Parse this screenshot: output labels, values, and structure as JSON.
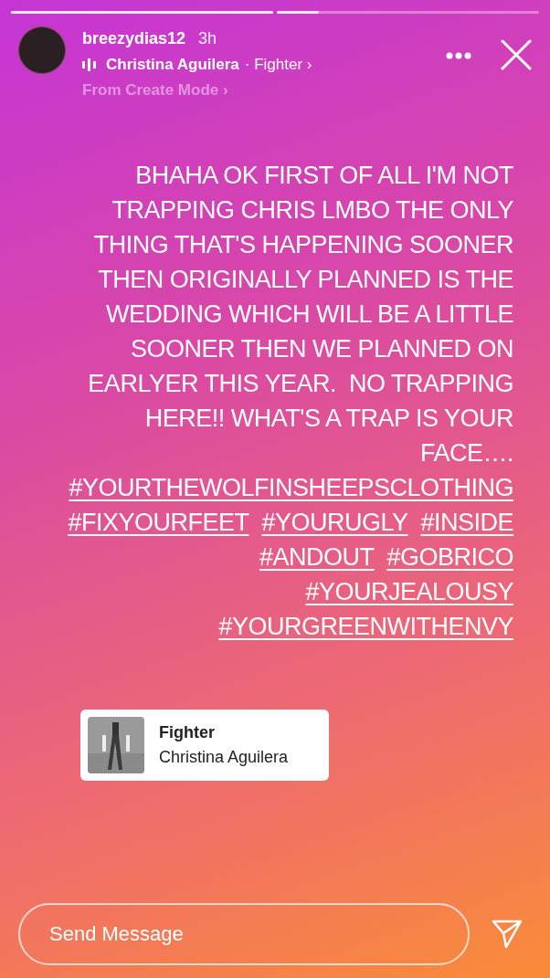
{
  "progress": [
    {
      "level": 1
    },
    {
      "level": 0.16
    }
  ],
  "header": {
    "username": "breezydias12",
    "time": "3h",
    "music_artist": "Christina Aguilera",
    "music_title": "· Fighter ›",
    "subtitle": "From Create Mode ›"
  },
  "story_text": "BHAHA OK FIRST OF ALL I'M NOT TRAPPING CHRIS LMBO THE ONLY THING THAT'S HAPPENING SOONER THEN ORIGINALLY PLANNED IS THE WEDDING WHICH WILL BE A LITTLE SOONER THEN WE PLANNED ON EARLYER THIS YEAR.  NO TRAPPING HERE!! WHAT'S A TRAP IS YOUR FACE….",
  "hashtags": [
    [
      "#YOURTHEWOLFINSHEEPSCLOTHING"
    ],
    [
      "#FIXYOURFEET",
      "#YOURUGLY",
      "#INSIDE"
    ],
    [
      "#ANDOUT",
      "#GOBRICO"
    ],
    [
      "#YOURJEALOUSY"
    ],
    [
      "#YOURGREENWITHENVY"
    ]
  ],
  "music_card": {
    "title": "Fighter",
    "artist": "Christina Aguilera"
  },
  "message": {
    "placeholder": "Send Message"
  }
}
